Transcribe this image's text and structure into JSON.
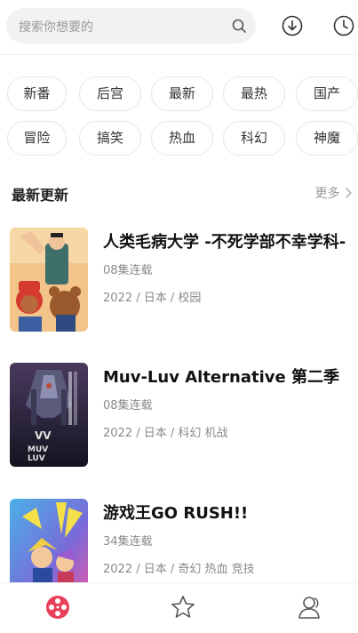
{
  "search": {
    "placeholder": "搜索你想要的",
    "icon": "search-icon"
  },
  "header_icons": [
    "download-icon",
    "history-clock-icon"
  ],
  "chips": [
    "新番",
    "后宫",
    "最新",
    "最热",
    "国产",
    "冒险",
    "搞笑",
    "热血",
    "科幻",
    "神魔"
  ],
  "section": {
    "title": "最新更新",
    "more_label": "更多"
  },
  "items": [
    {
      "title": "人类毛病大学 -不死学部不幸学科-",
      "episodes": "08集连载",
      "meta": "2022 / 日本 / 校园"
    },
    {
      "title": "Muv-Luv Alternative 第二季",
      "episodes": "08集连载",
      "meta": "2022 / 日本 / 科幻 机战"
    },
    {
      "title": "游戏王GO RUSH!!",
      "episodes": "34集连载",
      "meta": "2022 / 日本 / 奇幻 热血 竞技"
    }
  ],
  "bottom_nav": [
    {
      "icon": "film-reel-icon",
      "active": true
    },
    {
      "icon": "star-icon",
      "active": false
    },
    {
      "icon": "user-icon",
      "active": false
    }
  ],
  "colors": {
    "accent": "#e8405a",
    "chip_border": "#e6e6e6",
    "muted": "#8a8a8a"
  }
}
